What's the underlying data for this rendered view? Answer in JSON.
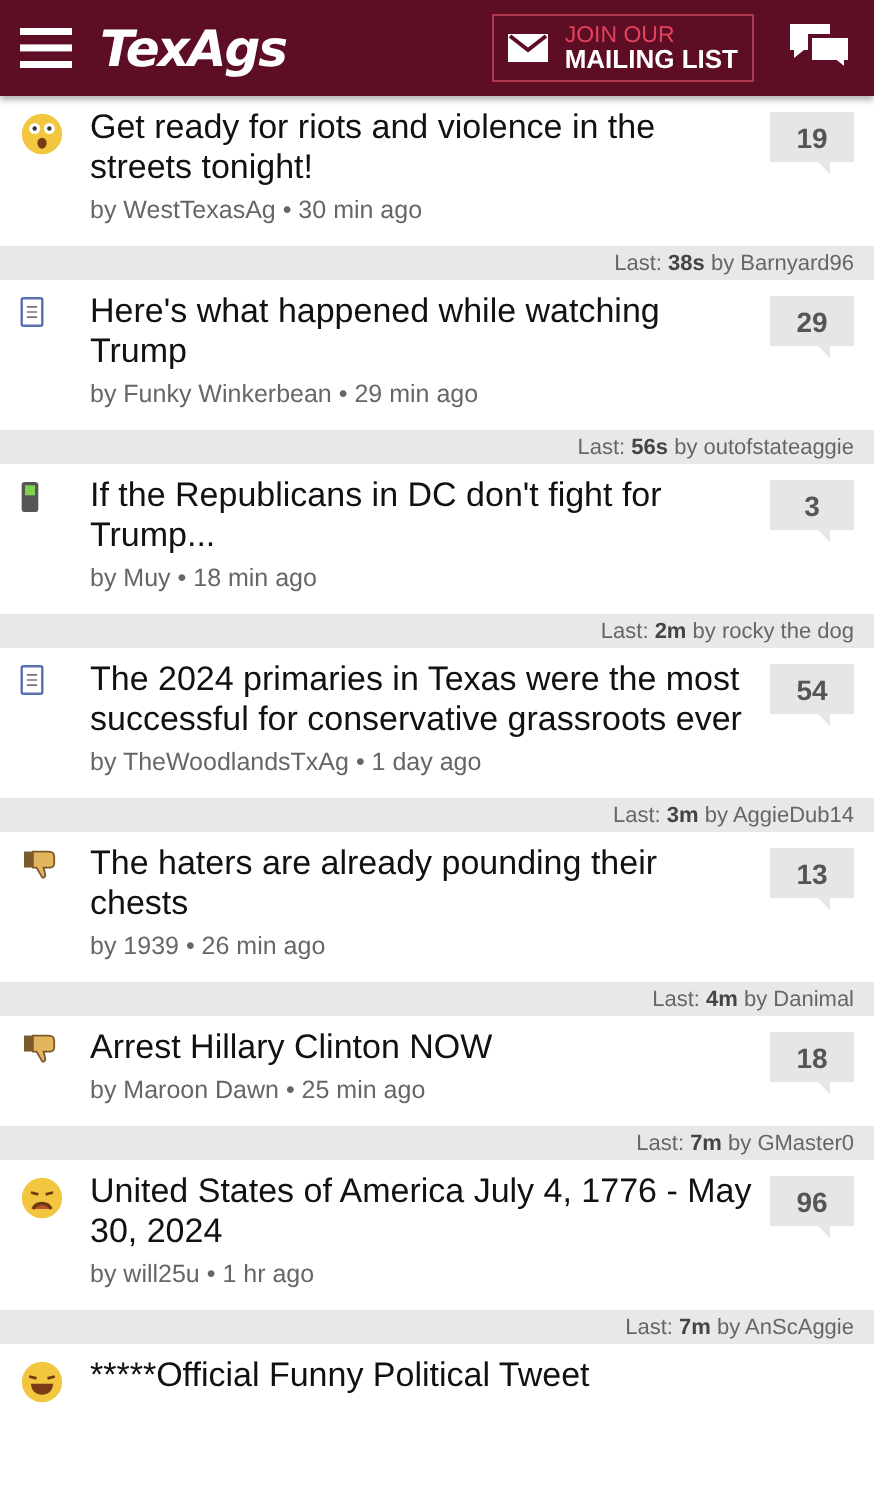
{
  "header": {
    "logo": "TexAgs",
    "mailing_button": {
      "line_1": "JOIN OUR",
      "line_2": "MAILING LIST"
    }
  },
  "threads": [
    {
      "kind": "shocked",
      "title": "Get ready for riots and violence in the streets tonight!",
      "meta": "by WestTexasAg • 30 min ago",
      "replies": "19",
      "last": "Last: **38s** by Barnyard96"
    },
    {
      "kind": "notes",
      "title": "Here's what happened while watching Trump",
      "meta": "by Funky Winkerbean • 29 min ago",
      "replies": "29",
      "last": "Last: **56s** by outofstateaggie"
    },
    {
      "kind": "phone",
      "title": "If the Republicans in DC don't fight for Trump...",
      "meta": "by Muy • 18 min ago",
      "replies": "3",
      "last": "Last: **2m** by rocky the dog"
    },
    {
      "kind": "notes",
      "title": "The 2024 primaries in Texas were the most successful for conservative grassroots ever",
      "meta": "by TheWoodlandsTxAg • 1 day ago",
      "replies": "54",
      "last": "Last: **3m** by AggieDub14"
    },
    {
      "kind": "thumbs-down",
      "title": "The haters are already pounding their chests",
      "meta": "by 1939 • 26 min ago",
      "replies": "13",
      "last": "Last: **4m** by Danimal"
    },
    {
      "kind": "thumbs-down",
      "title": "Arrest Hillary Clinton NOW",
      "meta": "by Maroon Dawn • 25 min ago",
      "replies": "18",
      "last": "Last: **7m** by GMaster0"
    },
    {
      "kind": "sad",
      "title": "United States of America July 4, 1776 - May 30, 2024",
      "meta": "by will25u • 1 hr ago",
      "replies": "96",
      "last": "Last: **7m** by AnScAggie"
    },
    {
      "kind": "laughing",
      "title": "*****Official Funny Political Tweet"
    }
  ]
}
